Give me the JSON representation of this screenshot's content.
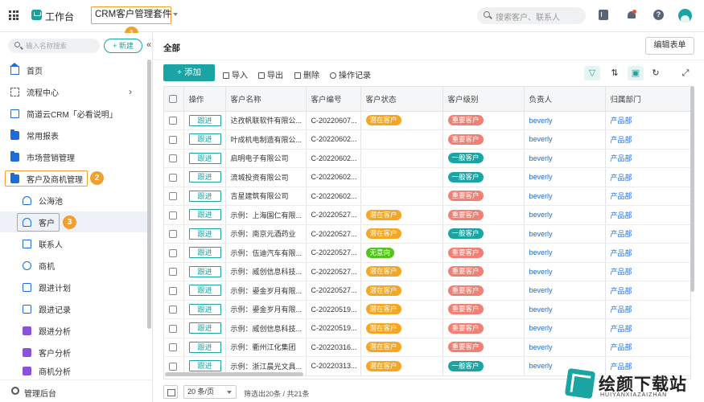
{
  "topbar": {
    "workbench": "工作台",
    "app_name": "CRM客户管理套件",
    "search_placeholder": "搜索客户、联系人",
    "help_label": "?"
  },
  "sidebar": {
    "search_placeholder": "输入名称搜索",
    "new_label": "+ 新建",
    "collapse_label": "«",
    "items": [
      {
        "label": "首页"
      },
      {
        "label": "流程中心",
        "arrow": "›"
      },
      {
        "label": "简道云CRM「必看说明」"
      },
      {
        "label": "常用报表"
      },
      {
        "label": "市场营销管理"
      },
      {
        "label": "客户及商机管理"
      },
      {
        "label": "公海池"
      },
      {
        "label": "客户"
      },
      {
        "label": "联系人"
      },
      {
        "label": "商机"
      },
      {
        "label": "跟进计划"
      },
      {
        "label": "跟进记录"
      },
      {
        "label": "跟进分析"
      },
      {
        "label": "客户分析"
      },
      {
        "label": "商机分析"
      }
    ],
    "admin_label": "管理后台"
  },
  "annotations": {
    "b1": "1",
    "b2": "2",
    "b3": "3"
  },
  "main": {
    "title": "全部",
    "edit_form": "编辑表单",
    "toolbar": {
      "add": "+ 添加",
      "import": "导入",
      "export": "导出",
      "delete": "删除",
      "log": "操作记录"
    },
    "columns": [
      "操作",
      "客户名称",
      "客户编号",
      "客户状态",
      "客户级别",
      "负责人",
      "归属部门"
    ],
    "rows": [
      {
        "action": "跟进",
        "name": "达孜帆联软件有限公...",
        "id": "C-20220607...",
        "status": "潜在客户",
        "level": "重要客户",
        "owner": "beverly",
        "dept": "产品部"
      },
      {
        "action": "跟进",
        "name": "叶成机电制造有限公...",
        "id": "C-20220602...",
        "status": "",
        "level": "重要客户",
        "owner": "beverly",
        "dept": "产品部"
      },
      {
        "action": "跟进",
        "name": "启明电子有限公司",
        "id": "C-20220602...",
        "status": "",
        "level": "一般客户",
        "owner": "beverly",
        "dept": "产品部"
      },
      {
        "action": "跟进",
        "name": "流城投资有限公司",
        "id": "C-20220602...",
        "status": "",
        "level": "一般客户",
        "owner": "beverly",
        "dept": "产品部"
      },
      {
        "action": "跟进",
        "name": "吉星建筑有限公司",
        "id": "C-20220602...",
        "status": "",
        "level": "重要客户",
        "owner": "beverly",
        "dept": "产品部"
      },
      {
        "action": "跟进",
        "name": "示例：上海国仁有限...",
        "id": "C-20220527...",
        "status": "潜在客户",
        "level": "重要客户",
        "owner": "beverly",
        "dept": "产品部"
      },
      {
        "action": "跟进",
        "name": "示例：南京元酒药业",
        "id": "C-20220527...",
        "status": "潜在客户",
        "level": "一般客户",
        "owner": "beverly",
        "dept": "产品部"
      },
      {
        "action": "跟进",
        "name": "示例：伍迪汽车有限...",
        "id": "C-20220527...",
        "status": "无意向",
        "level": "重要客户",
        "owner": "beverly",
        "dept": "产品部"
      },
      {
        "action": "跟进",
        "name": "示例：威创信息科技...",
        "id": "C-20220527...",
        "status": "潜在客户",
        "level": "重要客户",
        "owner": "beverly",
        "dept": "产品部"
      },
      {
        "action": "跟进",
        "name": "示例：鎏金岁月有限...",
        "id": "C-20220527...",
        "status": "潜在客户",
        "level": "重要客户",
        "owner": "beverly",
        "dept": "产品部"
      },
      {
        "action": "跟进",
        "name": "示例：鎏金岁月有限...",
        "id": "C-20220519...",
        "status": "潜在客户",
        "level": "重要客户",
        "owner": "beverly",
        "dept": "产品部"
      },
      {
        "action": "跟进",
        "name": "示例：威创信息科技...",
        "id": "C-20220519...",
        "status": "潜在客户",
        "level": "重要客户",
        "owner": "beverly",
        "dept": "产品部"
      },
      {
        "action": "跟进",
        "name": "示例：衢州江化集团",
        "id": "C-20220316...",
        "status": "潜在客户",
        "level": "重要客户",
        "owner": "beverly",
        "dept": "产品部"
      },
      {
        "action": "跟进",
        "name": "示例：浙江晨光文具...",
        "id": "C-20220313...",
        "status": "潜在客户",
        "level": "一般客户",
        "owner": "beverly",
        "dept": "产品部"
      }
    ],
    "footer": {
      "page_size": "20 条/页",
      "info": "筛选出20条 / 共21条"
    }
  },
  "colors": {
    "accent": "#1aa5a3",
    "潜在客户": "#f5a623",
    "无意向": "#52c41a",
    "重要客户": "#f08074",
    "一般客户": "#1aa5a3"
  },
  "watermark": {
    "title": "绘颜下载站",
    "sub": "HUIYANXIAZAIZHAN"
  }
}
